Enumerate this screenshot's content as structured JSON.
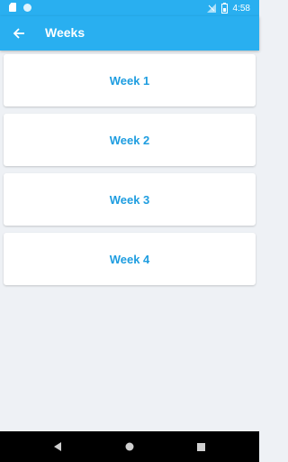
{
  "status_bar": {
    "time": "4:58",
    "icons": [
      "sd-card-icon",
      "sync-icon",
      "signal-icon",
      "battery-icon"
    ]
  },
  "header": {
    "title": "Weeks",
    "back_icon": "arrow-back-icon"
  },
  "weeks": [
    {
      "label": "Week 1"
    },
    {
      "label": "Week 2"
    },
    {
      "label": "Week 3"
    },
    {
      "label": "Week 4"
    }
  ],
  "nav_bar": {
    "buttons": [
      "back-triangle-icon",
      "home-circle-icon",
      "recents-square-icon"
    ]
  },
  "colors": {
    "primary": "#29aff0",
    "accent_text": "#1e9de0",
    "background": "#eef1f5",
    "card": "#ffffff",
    "nav_bar": "#000000"
  }
}
